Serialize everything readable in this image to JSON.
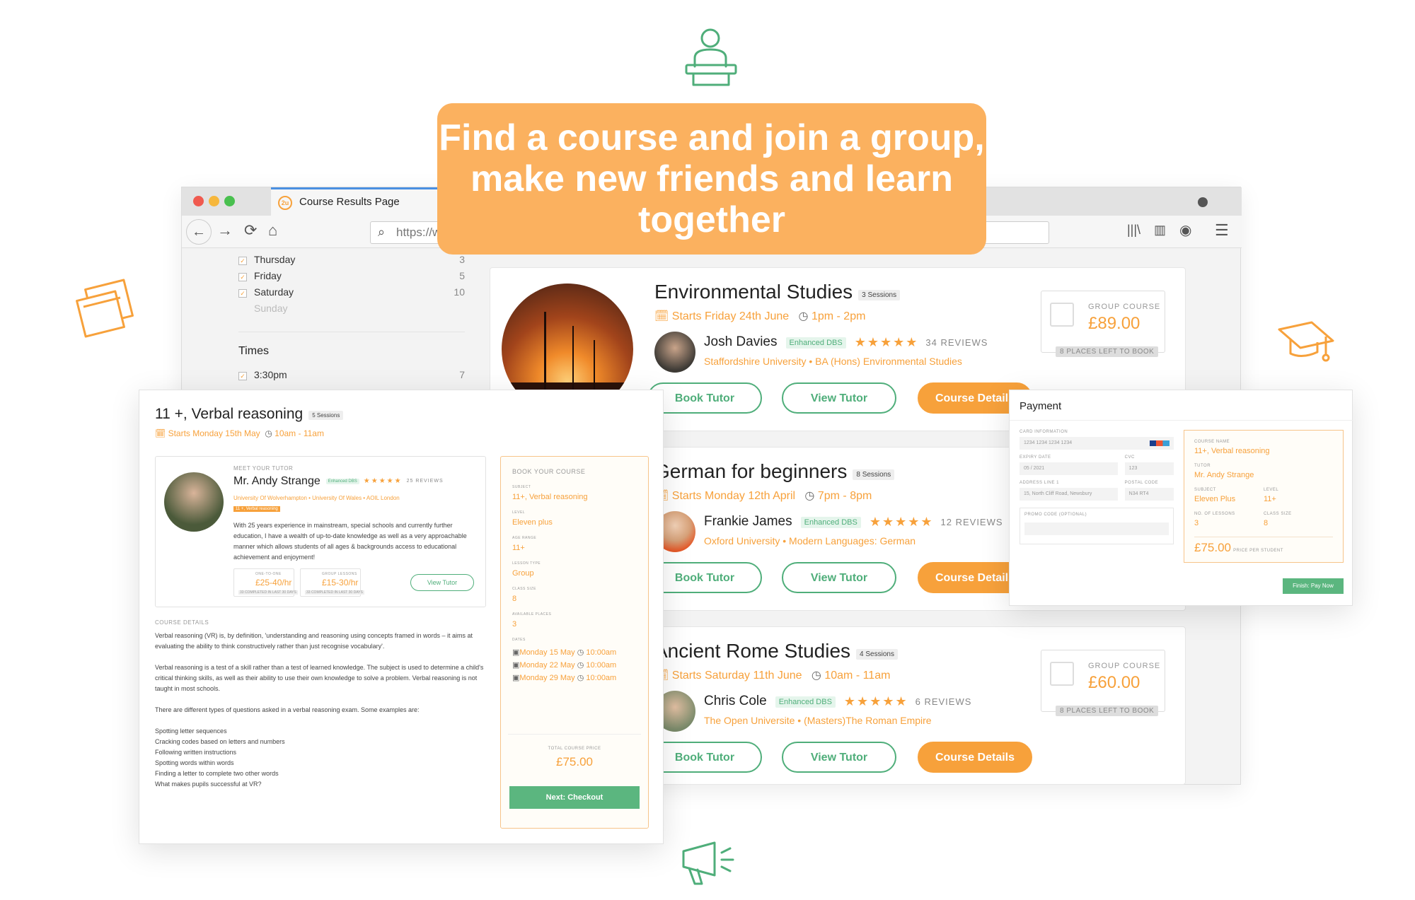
{
  "headline": {
    "text": "Find a course and join a group, make new friends and learn together"
  },
  "browser": {
    "tab_title": "Course Results Page",
    "url_placeholder": "https://www.2utoring.com",
    "url_text": "https://www.2utoring.com"
  },
  "filters": {
    "days": [
      {
        "label": "Thursday",
        "count": "3"
      },
      {
        "label": "Friday",
        "count": "5"
      },
      {
        "label": "Saturday",
        "count": "10"
      },
      {
        "label": "Sunday",
        "count": ""
      }
    ],
    "times_heading": "Times",
    "times": [
      {
        "label": "3:30pm",
        "count": "7"
      }
    ]
  },
  "courses": [
    {
      "title": "Environmental Studies",
      "sessions": "3 Sessions",
      "starts": "Starts Friday 24th June",
      "time": "1pm - 2pm",
      "tutor": "Josh Davies",
      "dbs": "Enhanced DBS",
      "stars": "★★★★★",
      "reviews": "34 REVIEWS",
      "university": "Staffordshire University",
      "qualification": "BA (Hons) Environmental Studies",
      "price_label": "GROUP COURSE",
      "price": "£89.00",
      "places": "8 PLACES LEFT TO BOOK",
      "btn_book": "Book Tutor",
      "btn_view": "View Tutor",
      "btn_details": "Course Details"
    },
    {
      "title": "German for beginners",
      "sessions": "8 Sessions",
      "starts": "Starts Monday 12th April",
      "time": "7pm - 8pm",
      "tutor": "Frankie James",
      "dbs": "Enhanced DBS",
      "stars": "★★★★★",
      "reviews": "12 REVIEWS",
      "university": "Oxford University",
      "qualification": "Modern Languages: German",
      "btn_book": "Book Tutor",
      "btn_view": "View Tutor",
      "btn_details": "Course Details"
    },
    {
      "title": "Ancient Rome Studies",
      "sessions": "4 Sessions",
      "starts": "Starts Saturday 11th June",
      "time": "10am - 11am",
      "tutor": "Chris Cole",
      "dbs": "Enhanced DBS",
      "stars": "★★★★★",
      "reviews": "6 REVIEWS",
      "university": "The Open Universite",
      "qualification": "(Masters)The Roman Empire",
      "price_label": "GROUP COURSE",
      "price": "£60.00",
      "places": "8 PLACES LEFT TO BOOK",
      "btn_book": "Book Tutor",
      "btn_view": "View Tutor",
      "btn_details": "Course Details"
    }
  ],
  "detail": {
    "title": "11 +, Verbal reasoning",
    "sessions": "5 Sessions",
    "starts": "Starts Monday 15th May",
    "time": "10am - 11am",
    "meet_label": "MEET YOUR TUTOR",
    "tutor": "Mr. Andy Strange",
    "dbs": "Enhanced DBS",
    "stars": "★★★★★",
    "reviews": "25 REVIEWS",
    "universities": "University Of Wolverhampton • University Of Wales • AOIL London",
    "tag": "11 +, Verbal reasoning",
    "bio": "With 25 years experience in mainstream, special schools and currently further education, I have a wealth of up-to-date knowledge as well as a very approachable manner which allows students of all ages & backgrounds access to educational achievement and enjoyment!",
    "one_to_one_label": "ONE-TO-ONE",
    "one_to_one_price": "£25-40/hr",
    "one_to_one_note": "33 COMPLETED IN LAST 30 DAYS",
    "group_label": "GROUP LESSONS",
    "group_price": "£15-30/hr",
    "group_note": "33 COMPLETED IN LAST 30 DAYS",
    "view_tutor": "View Tutor",
    "course_details_label": "COURSE DETAILS",
    "para1": "Verbal reasoning (VR) is, by definition, 'understanding and reasoning using concepts framed in words – it aims at evaluating the ability to think constructively rather than just recognise vocabulary'.",
    "para2": "Verbal reasoning is a test of a skill rather than a test of learned knowledge. The subject is used to determine a child's critical thinking skills, as well as their ability to use their own knowledge to solve a problem. Verbal reasoning is not taught in most schools.",
    "para3": "There are different types of questions asked in a verbal reasoning exam. Some examples are:",
    "examples": [
      "Spotting letter sequences",
      "Cracking codes based on letters and numbers",
      "Following written instructions",
      "Spotting words within words",
      "Finding a letter to complete two other words",
      "What makes pupils successful at VR?"
    ],
    "book": {
      "heading": "BOOK YOUR COURSE",
      "subject_label": "SUBJECT",
      "subject": "11+, Verbal reasoning",
      "level_label": "LEVEL",
      "level": "Eleven plus",
      "age_label": "AGE RANGE",
      "age": "11+",
      "type_label": "LESSON TYPE",
      "type": "Group",
      "size_label": "CLASS SIZE",
      "size": "8",
      "places_label": "AVAILABLE PLACES",
      "places": "3",
      "dates_label": "DATES",
      "dates": [
        {
          "date": "Monday 15 May",
          "time": "10:00am"
        },
        {
          "date": "Monday 22 May",
          "time": "10:00am"
        },
        {
          "date": "Monday 29 May",
          "time": "10:00am"
        }
      ],
      "total_label": "TOTAL COURSE PRICE",
      "total": "£75.00",
      "checkout": "Next: Checkout"
    }
  },
  "payment": {
    "title": "Payment",
    "card_label": "CARD INFORMATION",
    "card_value": "1234 1234 1234 1234",
    "expiry_label": "EXPIRY DATE",
    "expiry_value": "05 / 2021",
    "cvc_label": "CVC",
    "cvc_value": "123",
    "address_label": "ADDRESS LINE 1",
    "address_value": "15, North Cliff Road, Newsbury",
    "postal_label": "POSTAL CODE",
    "postal_value": "N34 RT4",
    "promo_label": "PROMO CODE (OPTIONAL)",
    "course_label": "COURSE NAME",
    "course": "11+, Verbal reasoning",
    "tutor_label": "TUTOR",
    "tutor": "Mr. Andy Strange",
    "subject_label": "SUBJECT",
    "subject": "Eleven Plus",
    "level_label": "LEVEL",
    "level": "11+",
    "lessons_label": "NO. OF LESSONS",
    "lessons": "3",
    "size_label": "CLASS SIZE",
    "size": "8",
    "price": "£75.00",
    "price_note": "PRICE PER STUDENT",
    "pay_button": "Finish: Pay Now"
  },
  "colors": {
    "accent": "#f7a13b",
    "green": "#4fae7a",
    "headline_bg": "#fbb15f"
  }
}
